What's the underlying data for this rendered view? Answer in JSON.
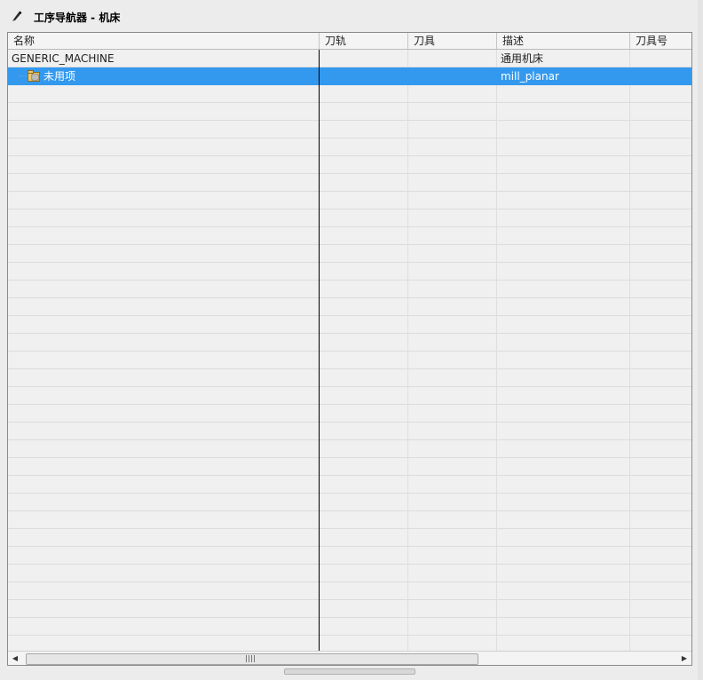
{
  "window": {
    "title": "工序导航器 - 机床",
    "icon": "pencil-icon"
  },
  "table": {
    "columns": [
      {
        "label": "名称"
      },
      {
        "label": "刀轨"
      },
      {
        "label": "刀具"
      },
      {
        "label": "描述"
      },
      {
        "label": "刀具号"
      }
    ],
    "rows": [
      {
        "name": "GENERIC_MACHINE",
        "toolpath": "",
        "tool": "",
        "description": "通用机床",
        "tool_number": "",
        "selected": false
      },
      {
        "name": "未用项",
        "toolpath": "",
        "tool": "",
        "description": "mill_planar",
        "tool_number": "",
        "selected": true,
        "icon": "folder-icon"
      }
    ]
  },
  "scrollbar": {
    "left_arrow": "◀",
    "right_arrow": "▶"
  },
  "colors": {
    "selection": "#3399ee",
    "background": "#f0f0f0"
  }
}
